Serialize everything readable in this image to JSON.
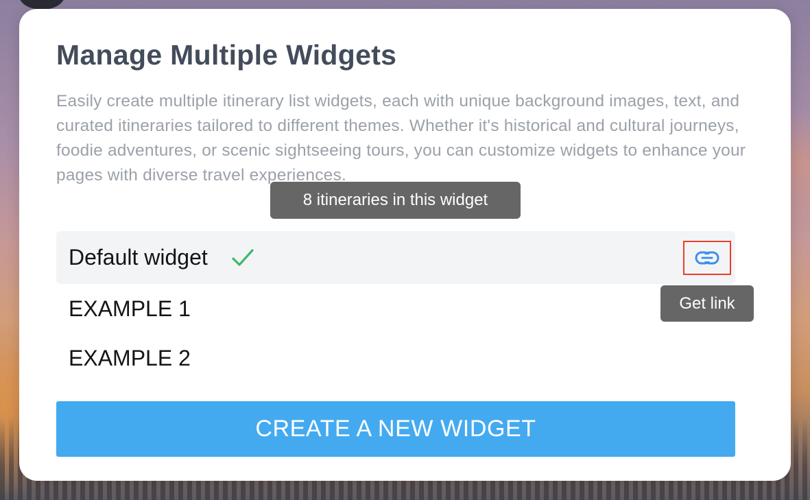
{
  "dialog": {
    "title": "Manage Multiple Widgets",
    "description": "Easily create multiple itinerary list widgets, each with unique background images, text, and curated itineraries tailored to different themes. Whether it's historical and cultural journeys, foodie adventures, or scenic sightseeing tours, you can customize widgets to enhance your pages with diverse travel experiences."
  },
  "widgets": [
    {
      "name": "Default widget",
      "selected": true
    },
    {
      "name": "EXAMPLE 1",
      "selected": false
    },
    {
      "name": "EXAMPLE 2",
      "selected": false
    }
  ],
  "tooltips": {
    "itineraries": "8 itineraries in this widget",
    "get_link": "Get link"
  },
  "create_button": {
    "label": "CREATE A NEW WIDGET"
  },
  "icons": {
    "selected": "check-icon",
    "get_link": "link-icon"
  },
  "colors": {
    "primary_button": "#44aaf0",
    "check": "#3cb868",
    "link_icon": "#3a8ff0",
    "highlight_border": "#e8402a",
    "tooltip_bg": "#666666"
  }
}
